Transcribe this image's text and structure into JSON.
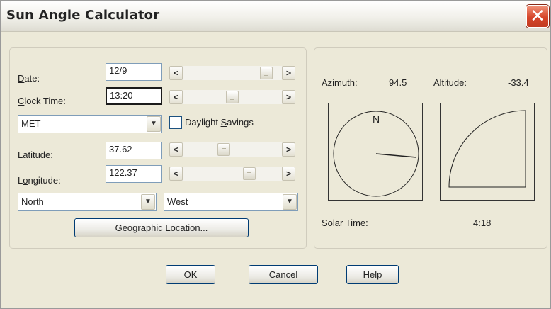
{
  "window": {
    "title": "Sun Angle Calculator",
    "close_glyph": "✕"
  },
  "fields": {
    "date": {
      "label_ul": "D",
      "label_rest": "ate:",
      "value": "12/9"
    },
    "clock_time": {
      "label_ul": "C",
      "label_rest": "lock Time:",
      "value": "13:20"
    },
    "timezone": {
      "value": "MET"
    },
    "daylight": {
      "label_pre": "Daylight ",
      "label_ul": "S",
      "label_post": "avings",
      "checked": false
    },
    "latitude": {
      "label_pre": "",
      "label_ul": "L",
      "label_post": "atitude:",
      "value": "37.62"
    },
    "longitude": {
      "label_pre": "L",
      "label_ul": "o",
      "label_post": "ngitude:",
      "value": "122.37"
    },
    "hemisphere_ns": {
      "value": "North"
    },
    "hemisphere_ew": {
      "value": "West"
    }
  },
  "scrollbars": {
    "date": {
      "position": 0.92
    },
    "clock_time": {
      "position": 0.56
    },
    "latitude": {
      "position": 0.44
    },
    "longitude": {
      "position": 0.72
    }
  },
  "buttons": {
    "geo": {
      "ul": "G",
      "rest": "eographic Location..."
    },
    "ok": {
      "label": "OK"
    },
    "cancel": {
      "label": "Cancel"
    },
    "help": {
      "ul": "H",
      "rest": "elp"
    }
  },
  "results": {
    "azimuth_label": "Azimuth:",
    "azimuth_value": "94.5",
    "altitude_label": "Altitude:",
    "altitude_value": "-33.4",
    "solar_time_label": "Solar Time:",
    "solar_time_value": "4:18",
    "compass_north": "N"
  },
  "icons": {
    "scroll_left": "<",
    "scroll_right": ">",
    "dropdown": "▼"
  },
  "colors": {
    "close_red": "#d6452a",
    "field_border": "#7f9db9",
    "button_border": "#003c74"
  }
}
